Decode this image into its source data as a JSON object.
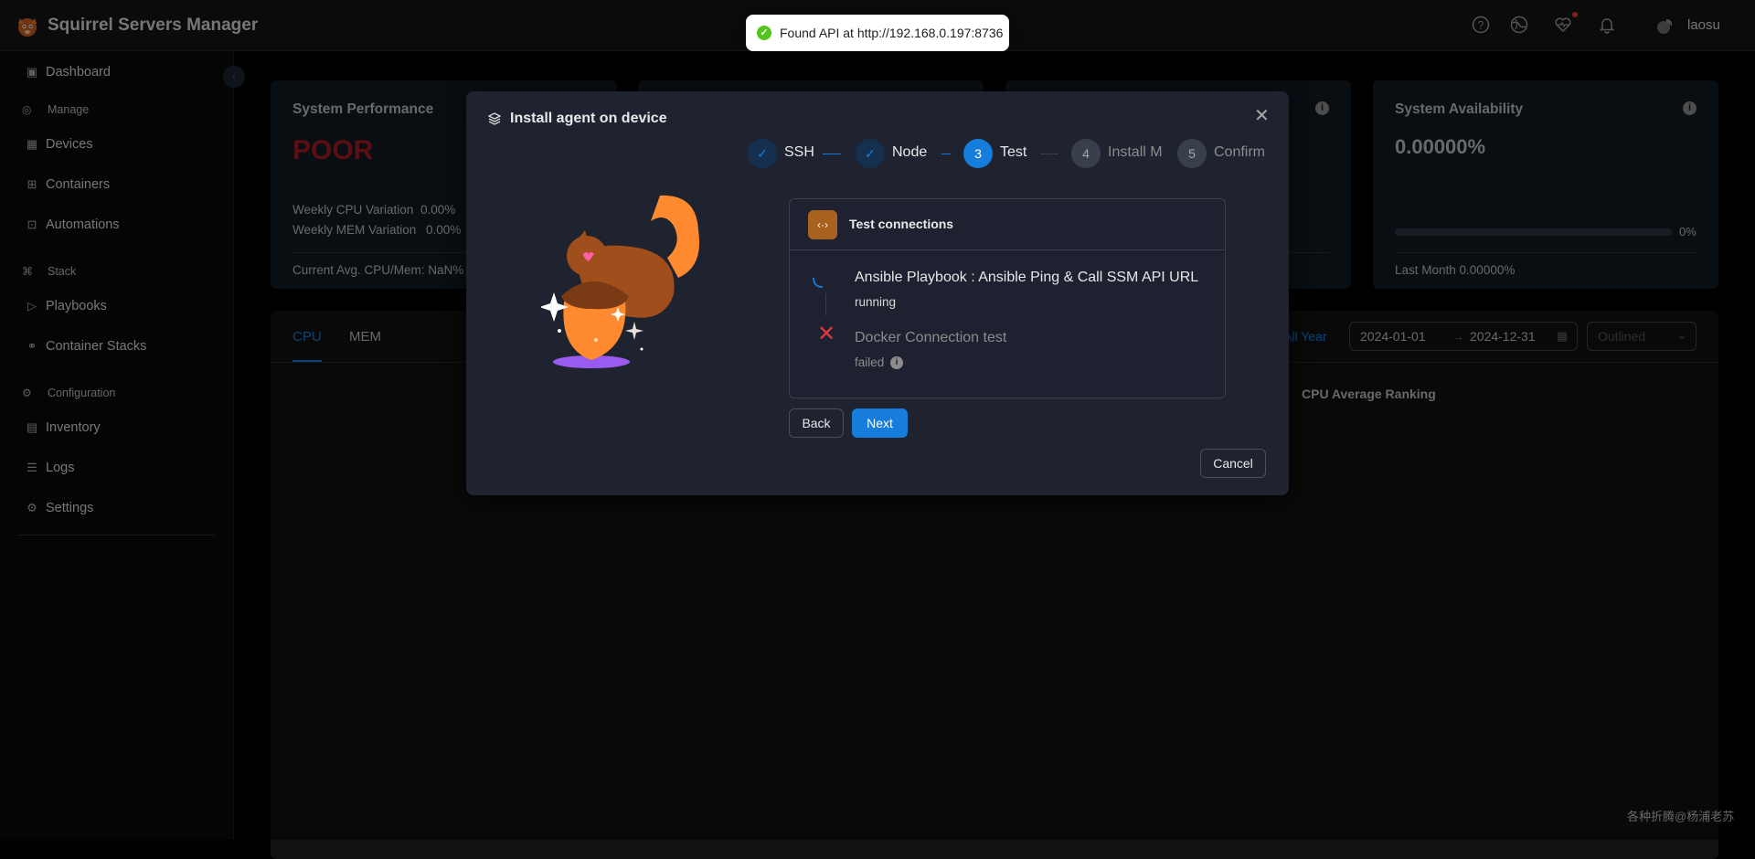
{
  "app": {
    "title": "Squirrel Servers Manager",
    "username": "laosu"
  },
  "toast": {
    "message": "Found API at http://192.168.0.197:8736",
    "status_color": "#52c41a"
  },
  "header_icons": [
    "question-circle-icon",
    "globe-icon",
    "heart-pulse-icon",
    "bell-icon",
    "avatar-icon"
  ],
  "sidebar": {
    "items": [
      {
        "label": "Dashboard",
        "icon": "dashboard-icon",
        "type": "item"
      },
      {
        "label": "Manage",
        "icon": "globe-icon",
        "type": "group"
      },
      {
        "label": "Devices",
        "icon": "table-icon",
        "type": "item"
      },
      {
        "label": "Containers",
        "icon": "container-icon",
        "type": "item"
      },
      {
        "label": "Automations",
        "icon": "automation-icon",
        "type": "item"
      },
      {
        "label": "Stack",
        "icon": "stack-icon",
        "type": "group"
      },
      {
        "label": "Playbooks",
        "icon": "play-icon",
        "type": "item"
      },
      {
        "label": "Container Stacks",
        "icon": "cluster-icon",
        "type": "item"
      },
      {
        "label": "Configuration",
        "icon": "config-icon",
        "type": "group"
      },
      {
        "label": "Inventory",
        "icon": "inventory-icon",
        "type": "item"
      },
      {
        "label": "Logs",
        "icon": "list-icon",
        "type": "item"
      },
      {
        "label": "Settings",
        "icon": "gear-icon",
        "type": "item"
      }
    ]
  },
  "cards": {
    "perf": {
      "title": "System Performance",
      "status": "POOR",
      "status_color": "#a61d24",
      "cpu_var_label": "Weekly CPU Variation",
      "cpu_var_value": "0.00%",
      "mem_var_label": "Weekly MEM Variation",
      "mem_var_value": "0.00%",
      "footer": "Current Avg. CPU/Mem: NaN%"
    },
    "avail": {
      "title": "System Availability",
      "value": "0.00000%",
      "progress_label": "0%",
      "progress": 0,
      "footer": "Last Month 0.00000%"
    }
  },
  "main": {
    "tabs": [
      "CPU",
      "MEM"
    ],
    "range_label": "All Year",
    "date_start": "2024-01-01",
    "date_end": "2024-12-31",
    "select_value": "Outlined",
    "ranking_title": "CPU Average Ranking"
  },
  "modal": {
    "title": "Install agent on device",
    "steps": [
      {
        "num": "1",
        "label": "SSH",
        "state": "done"
      },
      {
        "num": "2",
        "label": "Node",
        "state": "done"
      },
      {
        "num": "3",
        "label": "Test",
        "state": "active"
      },
      {
        "num": "4",
        "label": "Install M",
        "state": "wait"
      },
      {
        "num": "5",
        "label": "Confirm",
        "state": "wait"
      }
    ],
    "test_panel": {
      "title": "Test connections",
      "tests": [
        {
          "name": "Ansible Playbook : Ansible Ping & Call SSM API URL",
          "status": "running"
        },
        {
          "name": "Docker Connection test",
          "status": "failed"
        }
      ]
    },
    "back_label": "Back",
    "next_label": "Next",
    "cancel_label": "Cancel"
  },
  "watermark": "各种折腾@杨浦老苏"
}
